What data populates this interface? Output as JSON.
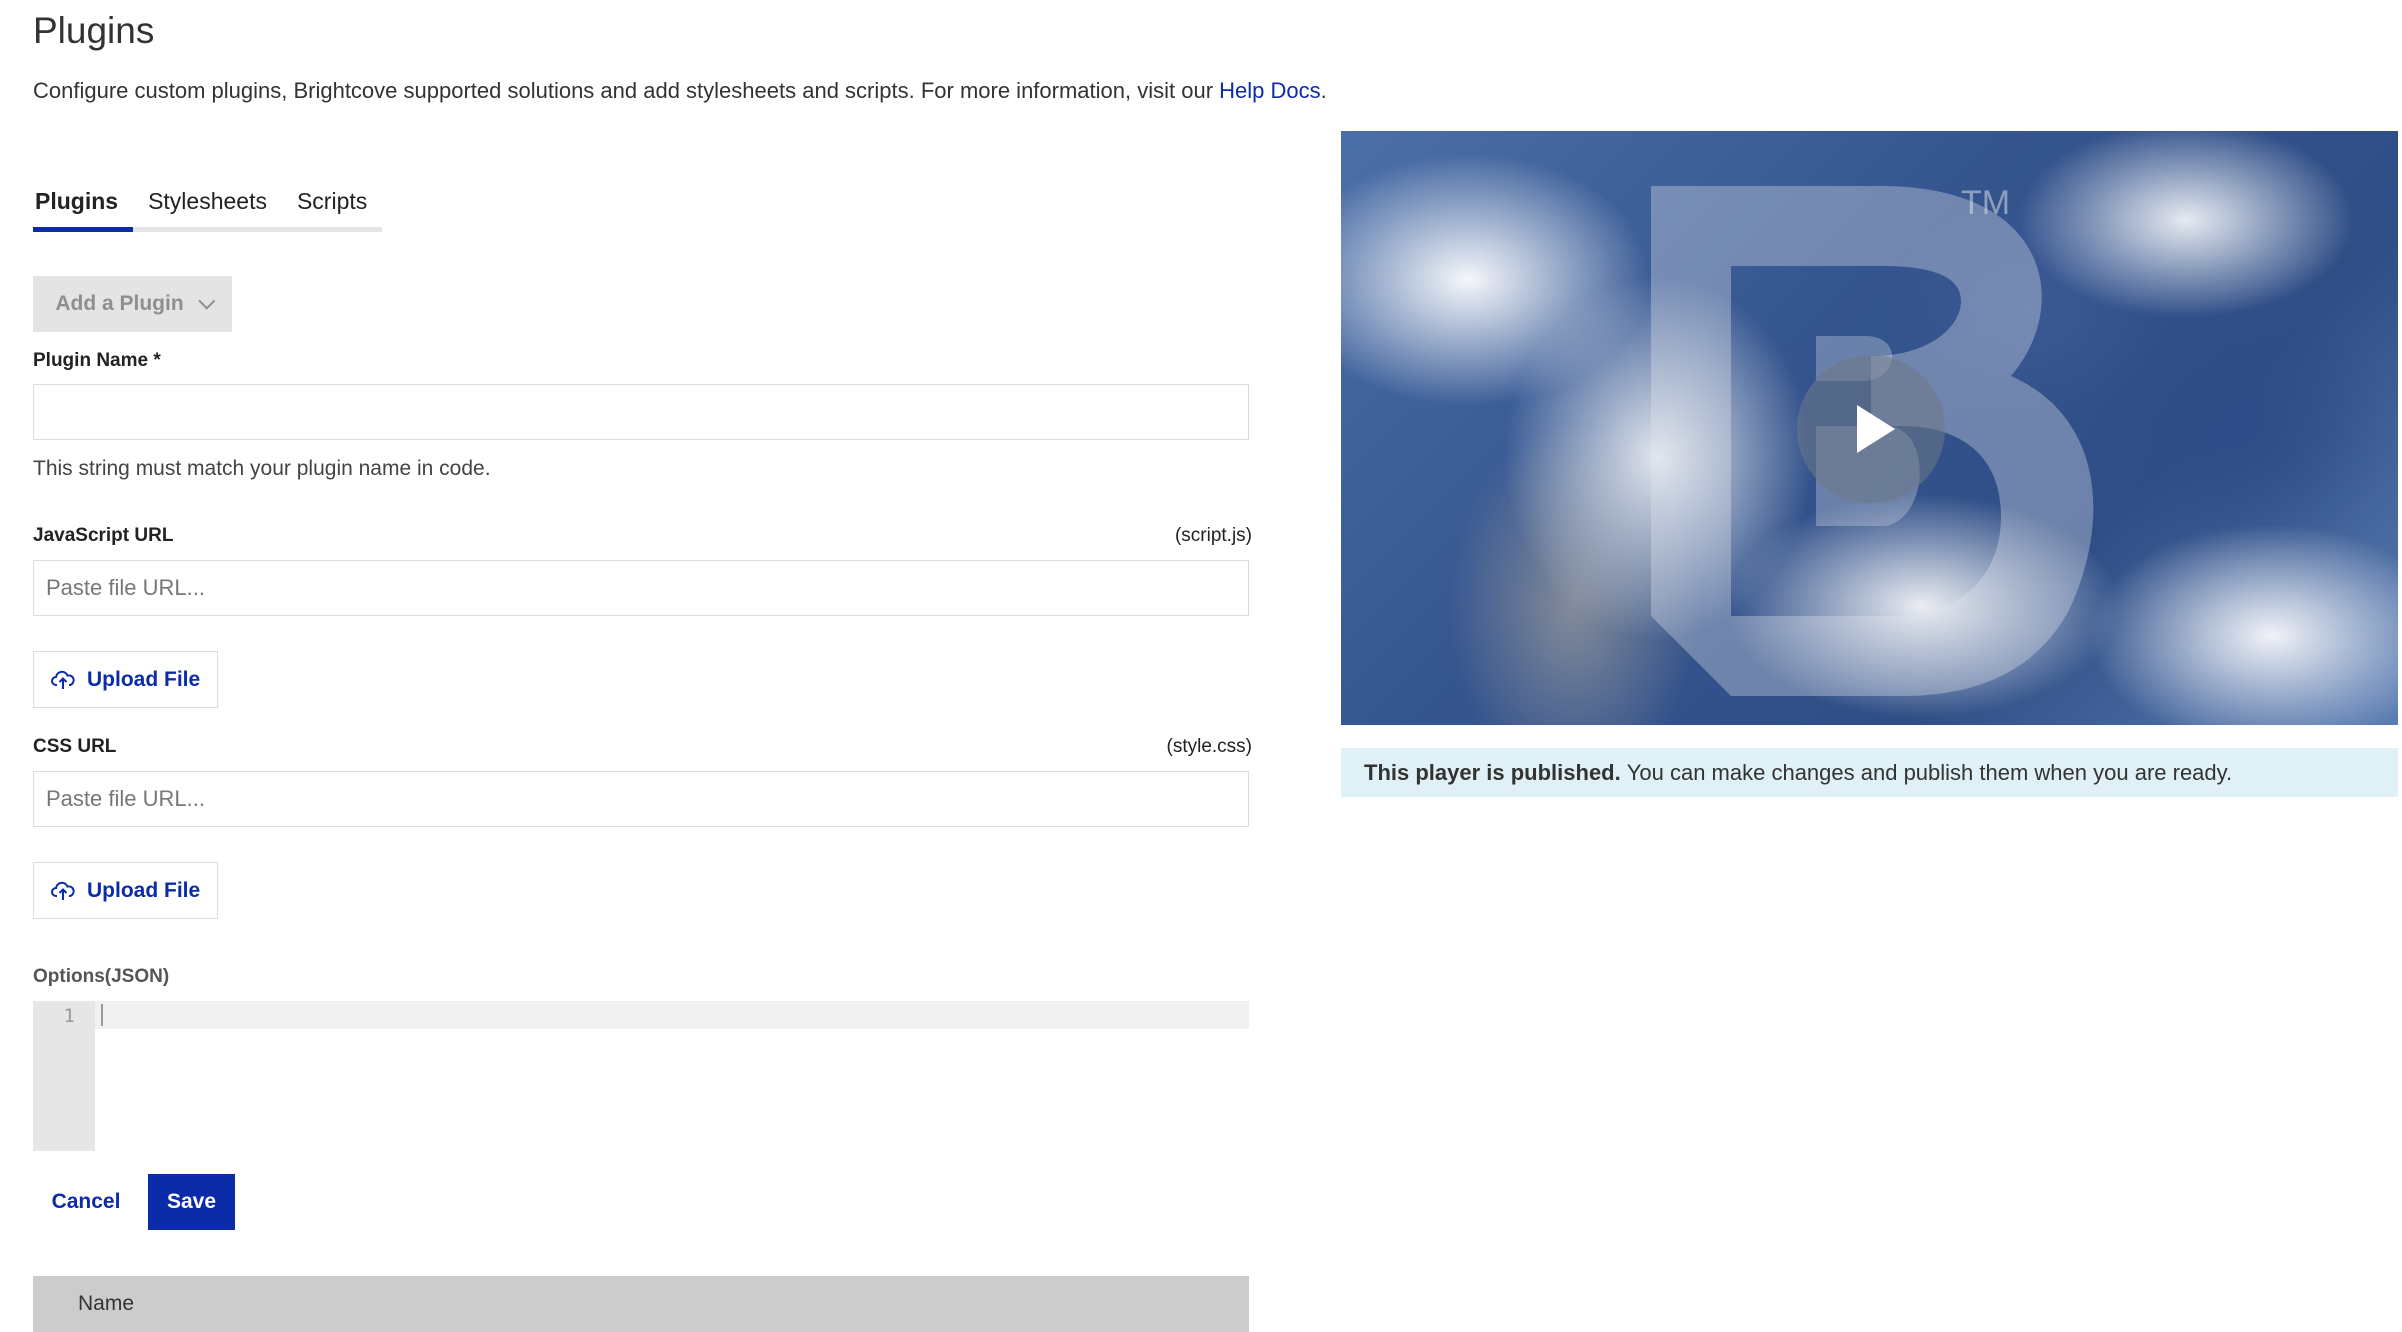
{
  "page": {
    "title": "Plugins",
    "intro_text": "Configure custom plugins, Brightcove supported solutions and add stylesheets and scripts. For more information, visit our ",
    "intro_link": "Help Docs",
    "intro_end": "."
  },
  "tabs": [
    {
      "label": "Plugins",
      "active": true
    },
    {
      "label": "Stylesheets",
      "active": false
    },
    {
      "label": "Scripts",
      "active": false
    }
  ],
  "form": {
    "add_plugin_label": "Add a Plugin",
    "plugin_name_label": "Plugin Name *",
    "plugin_name_value": "",
    "plugin_name_help": "This string must match your plugin name in code.",
    "js_url_label": "JavaScript URL",
    "js_url_hint": "(script.js)",
    "js_url_placeholder": "Paste file URL...",
    "css_url_label": "CSS URL",
    "css_url_hint": "(style.css)",
    "css_url_placeholder": "Paste file URL...",
    "upload_label": "Upload File",
    "options_label": "Options(JSON)",
    "editor_line_number": "1",
    "cancel_label": "Cancel",
    "save_label": "Save"
  },
  "table": {
    "header_name": "Name"
  },
  "player": {
    "logo_tm": "TM",
    "status_bold": "This player is published.",
    "status_text": "You can make changes and publish them when you are ready."
  },
  "colors": {
    "brand_blue": "#0b2ba9",
    "status_bg": "#dff0f7"
  },
  "icons": [
    "upload-cloud-icon",
    "chevron-down-icon",
    "play-icon"
  ]
}
